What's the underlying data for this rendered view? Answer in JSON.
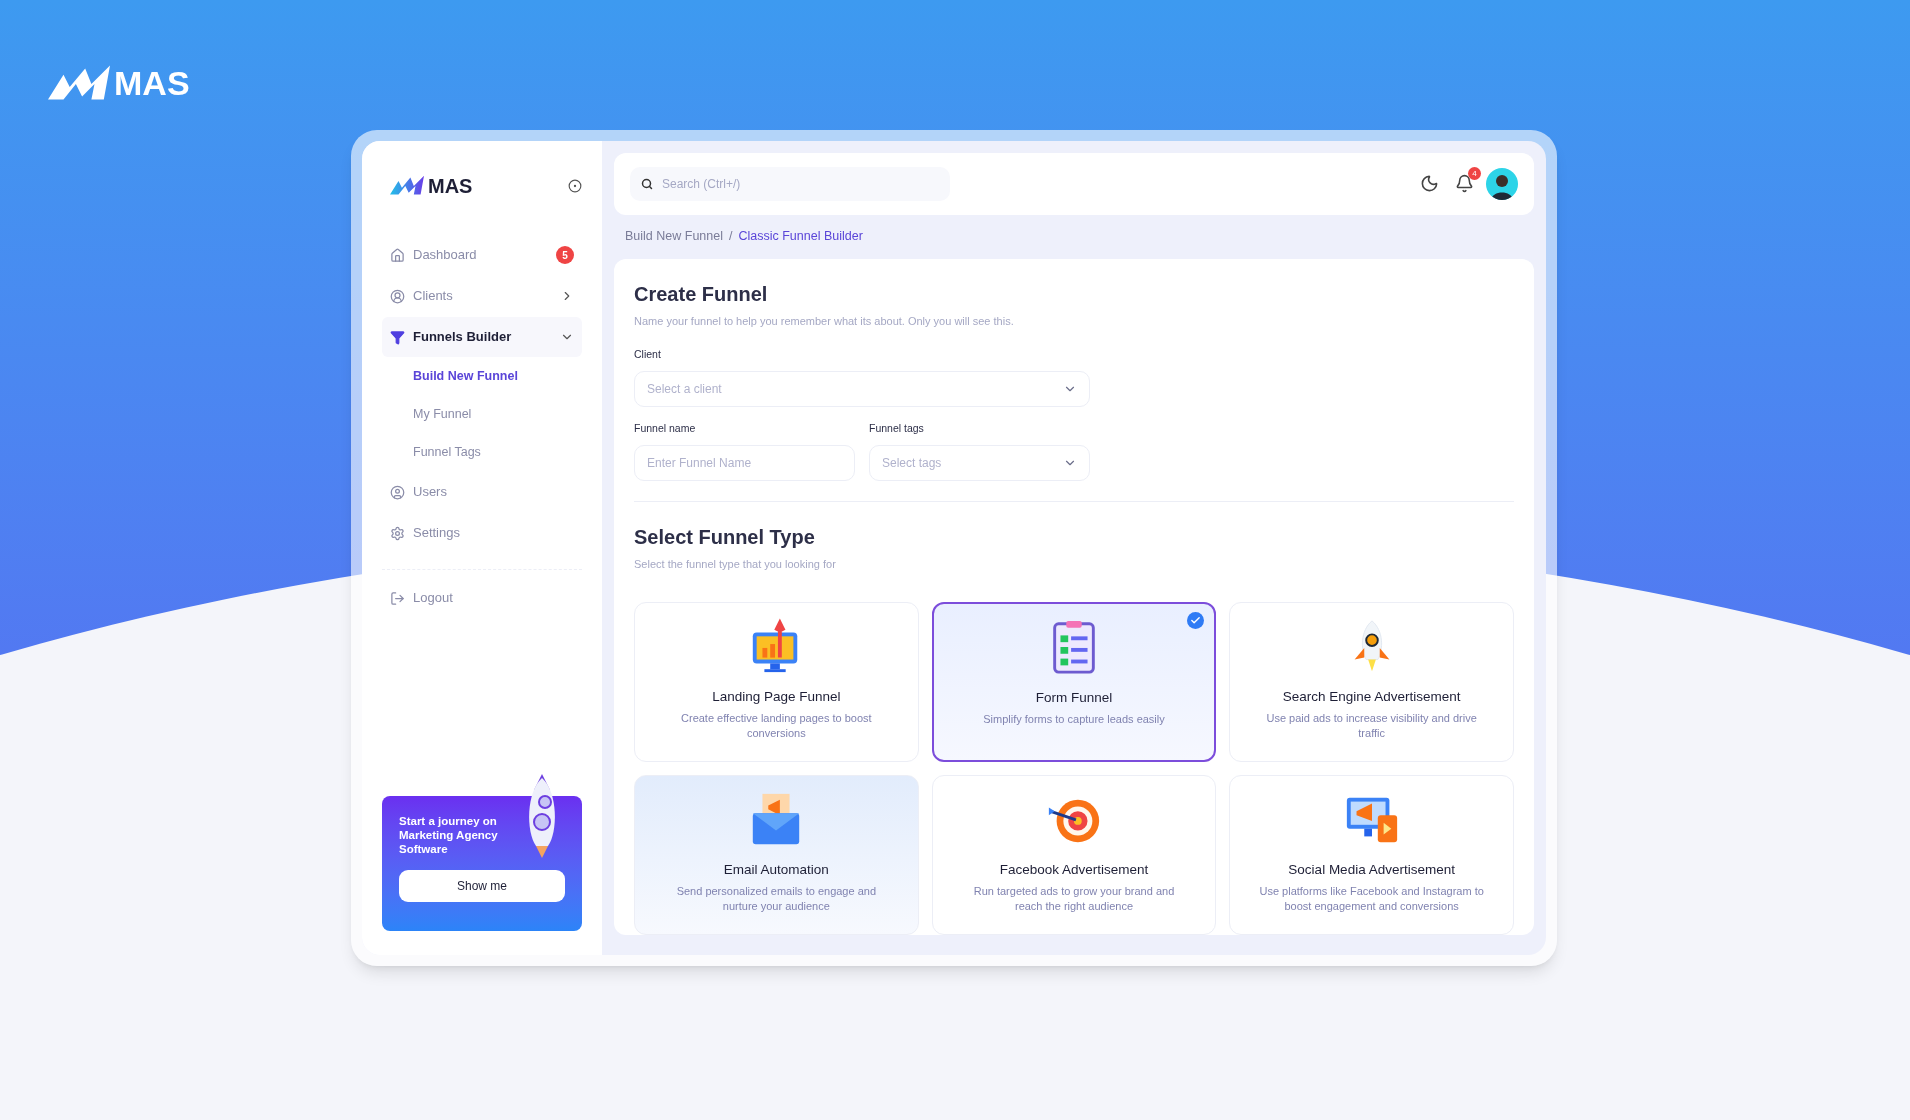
{
  "brand": {
    "name": "MAS"
  },
  "sidebar": {
    "logo": "MAS",
    "items": [
      {
        "kind": "link",
        "label": "Dashboard",
        "badge": "5",
        "selected": false
      },
      {
        "kind": "group",
        "label": "Clients",
        "selected": false,
        "expanded": false
      },
      {
        "kind": "group",
        "label": "Funnels Builder",
        "selected": true,
        "expanded": true,
        "children": [
          {
            "label": "Build New Funnel",
            "selected": true
          },
          {
            "label": "My Funnel",
            "selected": false
          },
          {
            "label": "Funnel Tags",
            "selected": false
          }
        ]
      },
      {
        "kind": "link",
        "label": "Users",
        "selected": false
      },
      {
        "kind": "link",
        "label": "Settings",
        "selected": false
      }
    ],
    "logout": "Logout",
    "promo": {
      "text": "Start a journey on Marketing Agency Software",
      "button": "Show me"
    }
  },
  "header": {
    "search": {
      "placeholder": "Search (Ctrl+/)"
    },
    "notifications": "4"
  },
  "breadcrumb": {
    "separator": "/",
    "items": [
      {
        "label": "Build New Funnel",
        "current": false
      },
      {
        "label": "Classic Funnel Builder",
        "current": true
      }
    ]
  },
  "create_funnel": {
    "title": "Create Funnel",
    "subtitle": "Name your funnel to help you remember what its about. Only you will see this.",
    "fields": [
      {
        "kind": "select",
        "label": "Client",
        "placeholder": "Select a client"
      },
      {
        "kind": "input",
        "label": "Funnel name",
        "placeholder": "Enter Funnel Name"
      },
      {
        "kind": "select",
        "label": "Funnel tags",
        "placeholder": "Select tags"
      }
    ]
  },
  "funnel_types": {
    "title": "Select Funnel Type",
    "subtitle": "Select the funnel type that you looking for",
    "cards": [
      {
        "title": "Landing Page Funnel",
        "description": "Create effective landing pages to boost conversions",
        "selected": false,
        "hovered": false
      },
      {
        "title": "Form Funnel",
        "description": "Simplify forms to capture leads easily",
        "selected": true,
        "hovered": false
      },
      {
        "title": "Search Engine Advertisement",
        "description": "Use paid ads to increase visibility and drive traffic",
        "selected": false,
        "hovered": false
      },
      {
        "title": "Email Automation",
        "description": "Send personalized emails to engage and nurture your audience",
        "selected": false,
        "hovered": true
      },
      {
        "title": "Facebook Advertisement",
        "description": "Run targeted ads to grow your brand and reach the right audience",
        "selected": false,
        "hovered": false
      },
      {
        "title": "Social Media Advertisement",
        "description": "Use platforms like Facebook and Instagram to boost engagement and conversions",
        "selected": false,
        "hovered": false
      }
    ]
  }
}
